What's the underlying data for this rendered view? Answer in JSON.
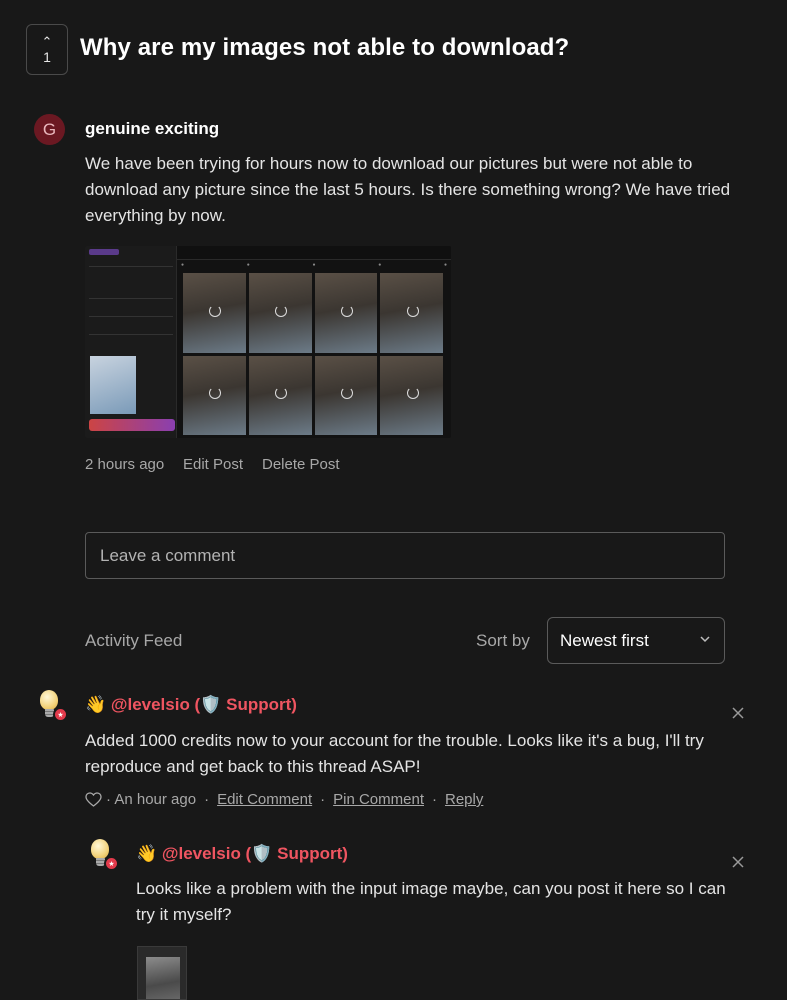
{
  "post": {
    "vote_count": "1",
    "title": "Why are my images not able to download?",
    "author_initial": "G",
    "author_name": "genuine exciting",
    "body": "We have been trying for hours now to download our pictures but were not able to download any picture since the last 5 hours. Is there something wrong? We have tried everything by now.",
    "time": "2 hours ago",
    "edit_label": "Edit Post",
    "delete_label": "Delete Post"
  },
  "comment_box": {
    "placeholder": "Leave a comment"
  },
  "feed": {
    "label": "Activity Feed",
    "sort_label": "Sort by",
    "sort_value": "Newest first"
  },
  "comments": [
    {
      "author": "👋 @levelsio (🛡️ Support)",
      "text": "Added 1000 credits now to your account for the trouble. Looks like it's a bug, I'll try reproduce and get back to this thread ASAP!",
      "time": "· An hour ago",
      "edit_label": "Edit Comment",
      "pin_label": "Pin Comment",
      "reply_label": "Reply"
    },
    {
      "author": "👋 @levelsio (🛡️ Support)",
      "text": "Looks like a problem with the input image maybe, can you post it here so I can try it myself?"
    }
  ],
  "icons": {
    "vote": "chevron-up-icon",
    "sort": "chevron-down-icon",
    "like": "heart-icon",
    "close": "close-icon",
    "avatar_badge": "star-icon"
  },
  "colors": {
    "background": "#181818",
    "accent": "#ef5561",
    "avatar": "#6b1822"
  }
}
